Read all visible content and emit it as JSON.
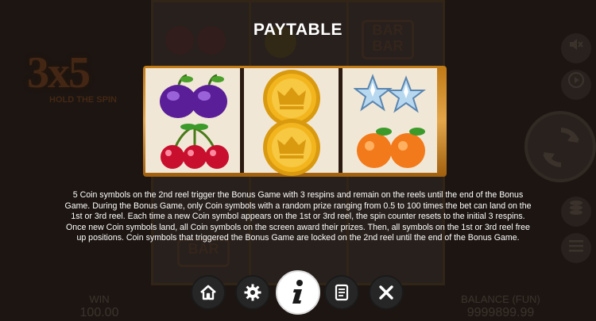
{
  "paytable": {
    "title": "PAYTABLE",
    "description": "5 Coin symbols on the 2nd reel trigger the Bonus Game with 3 respins and remain on the reels until the end of the Bonus Game. During the Bonus Game, only Coin symbols with a random prize ranging from 0.5 to 100 times the bet can land on the 1st or 3rd reel. Each time a new Coin symbol appears on the 1st or 3rd reel, the spin counter resets to the initial 3 respins. Once new Coin symbols land, all Coin symbols on the screen award their prizes. Then, all symbols on the 1st or 3rd reel free up positions. Coin symbols that triggered the Bonus Game are locked on the 2nd reel until the end of the Bonus Game.",
    "reels": [
      {
        "symbols": [
          "plum-icon",
          "cherry-icon"
        ]
      },
      {
        "symbols": [
          "coin-crown-icon",
          "coin-crown-icon"
        ]
      },
      {
        "symbols": [
          "star-icon",
          "orange-icon"
        ]
      }
    ]
  },
  "background_game": {
    "logo_text": "3x5",
    "logo_subtitle": "HOLD THE SPIN",
    "bar_label": "BAR",
    "win_label": "WIN",
    "win_value": "100.00",
    "balance_label": "BALANCE (FUN)",
    "balance_value": "9999899.99"
  },
  "nav": {
    "buttons": [
      "home-icon",
      "gear-icon",
      "info-icon",
      "scroll-icon",
      "close-icon"
    ],
    "active": "info-icon"
  },
  "colors": {
    "frame_gold": "#d9952e",
    "reel_bg": "#f1e7d6",
    "coin_gold": "#f2b51e",
    "plum_purple": "#6a2aa5",
    "cherry_red": "#c8102e",
    "orange": "#f27a1a",
    "star_blue": "#b8d8f0"
  }
}
